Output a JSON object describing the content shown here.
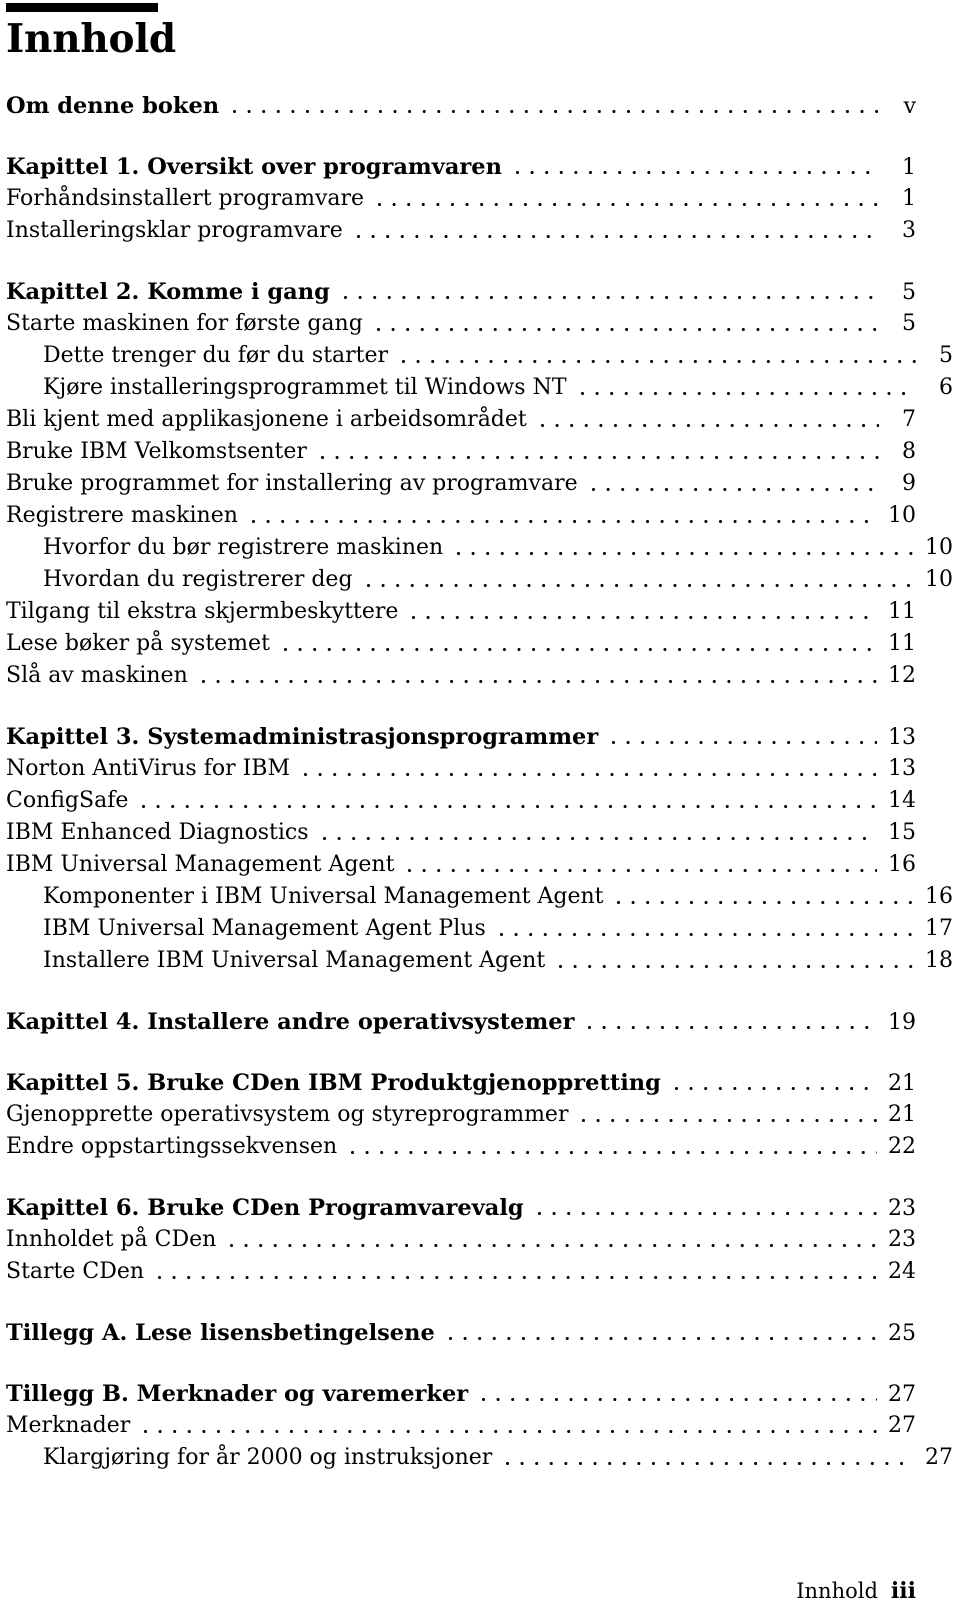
{
  "document": {
    "title": "Innhold",
    "footer": {
      "section_label": "Innhold",
      "folio": "iii"
    }
  },
  "toc": {
    "entries": [
      {
        "label": "Om denne boken",
        "page": "v",
        "level": "chapter",
        "gap_before": false
      },
      {
        "label": "Kapittel 1. Oversikt over programvaren",
        "page": "1",
        "level": "chapter",
        "gap_before": true
      },
      {
        "label": "Forhåndsinstallert programvare",
        "page": "1",
        "level": "entry",
        "gap_before": false
      },
      {
        "label": "Installeringsklar programvare",
        "page": "3",
        "level": "entry",
        "gap_before": false
      },
      {
        "label": "Kapittel 2. Komme i gang",
        "page": "5",
        "level": "chapter",
        "gap_before": true
      },
      {
        "label": "Starte maskinen for første gang",
        "page": "5",
        "level": "entry",
        "gap_before": false
      },
      {
        "label": "Dette trenger du før du starter",
        "page": "5",
        "level": "sub",
        "gap_before": false
      },
      {
        "label": "Kjøre installeringsprogrammet til Windows NT",
        "page": "6",
        "level": "sub",
        "gap_before": false
      },
      {
        "label": "Bli kjent med applikasjonene i arbeidsområdet",
        "page": "7",
        "level": "entry",
        "gap_before": false
      },
      {
        "label": "Bruke IBM Velkomstsenter",
        "page": "8",
        "level": "entry",
        "gap_before": false
      },
      {
        "label": "Bruke programmet for installering av programvare",
        "page": "9",
        "level": "entry",
        "gap_before": false
      },
      {
        "label": "Registrere maskinen",
        "page": "10",
        "level": "entry",
        "gap_before": false
      },
      {
        "label": "Hvorfor du bør registrere maskinen",
        "page": "10",
        "level": "sub",
        "gap_before": false
      },
      {
        "label": "Hvordan du registrerer deg",
        "page": "10",
        "level": "sub",
        "gap_before": false
      },
      {
        "label": "Tilgang til ekstra skjermbeskyttere",
        "page": "11",
        "level": "entry",
        "gap_before": false
      },
      {
        "label": "Lese bøker på systemet",
        "page": "11",
        "level": "entry",
        "gap_before": false
      },
      {
        "label": "Slå av maskinen",
        "page": "12",
        "level": "entry",
        "gap_before": false
      },
      {
        "label": "Kapittel 3. Systemadministrasjonsprogrammer",
        "page": "13",
        "level": "chapter",
        "gap_before": true
      },
      {
        "label": "Norton AntiVirus for IBM",
        "page": "13",
        "level": "entry",
        "gap_before": false
      },
      {
        "label": "ConfigSafe",
        "page": "14",
        "level": "entry",
        "gap_before": false
      },
      {
        "label": "IBM Enhanced Diagnostics",
        "page": "15",
        "level": "entry",
        "gap_before": false
      },
      {
        "label": "IBM Universal Management Agent",
        "page": "16",
        "level": "entry",
        "gap_before": false
      },
      {
        "label": "Komponenter i IBM Universal Management Agent",
        "page": "16",
        "level": "sub",
        "gap_before": false
      },
      {
        "label": "IBM Universal Management Agent Plus",
        "page": "17",
        "level": "sub",
        "gap_before": false
      },
      {
        "label": "Installere IBM Universal Management Agent",
        "page": "18",
        "level": "sub",
        "gap_before": false
      },
      {
        "label": "Kapittel 4. Installere andre operativsystemer",
        "page": "19",
        "level": "chapter",
        "gap_before": true
      },
      {
        "label": "Kapittel 5. Bruke CDen IBM Produktgjenoppretting",
        "page": "21",
        "level": "chapter",
        "gap_before": true
      },
      {
        "label": "Gjenopprette operativsystem og styreprogrammer",
        "page": "21",
        "level": "entry",
        "gap_before": false
      },
      {
        "label": "Endre oppstartingssekvensen",
        "page": "22",
        "level": "entry",
        "gap_before": false
      },
      {
        "label": "Kapittel 6. Bruke CDen Programvarevalg",
        "page": "23",
        "level": "chapter",
        "gap_before": true
      },
      {
        "label": "Innholdet på CDen",
        "page": "23",
        "level": "entry",
        "gap_before": false
      },
      {
        "label": "Starte CDen",
        "page": "24",
        "level": "entry",
        "gap_before": false
      },
      {
        "label": "Tillegg A. Lese lisensbetingelsene",
        "page": "25",
        "level": "chapter",
        "gap_before": true
      },
      {
        "label": "Tillegg B. Merknader og varemerker",
        "page": "27",
        "level": "chapter",
        "gap_before": true
      },
      {
        "label": "Merknader",
        "page": "27",
        "level": "entry",
        "gap_before": false
      },
      {
        "label": "Klargjøring for år 2000 og instruksjoner",
        "page": "27",
        "level": "sub",
        "gap_before": false
      }
    ]
  }
}
